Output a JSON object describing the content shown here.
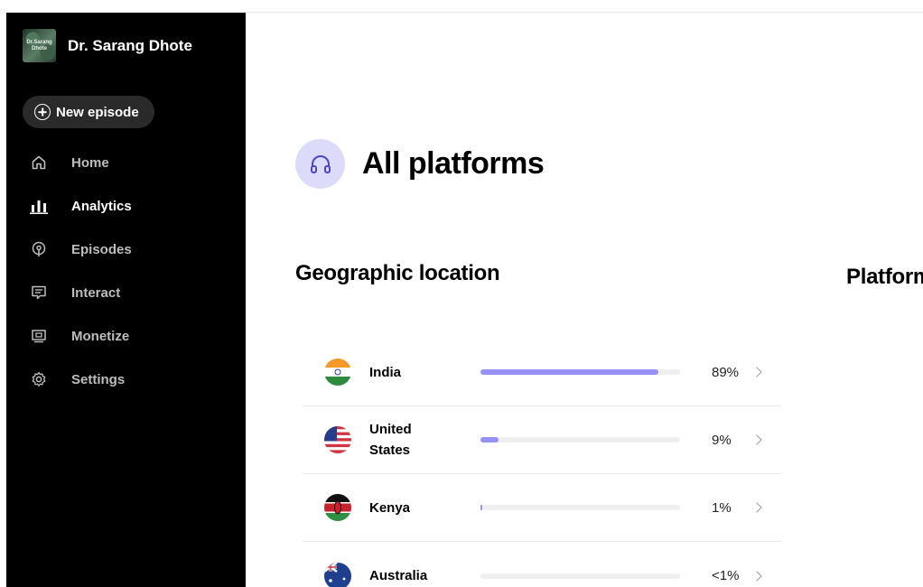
{
  "sidebar": {
    "show_name": "Dr. Sarang Dhote",
    "show_art_text": "Dr.Sarang Dhote",
    "new_episode_label": "New episode",
    "items": [
      {
        "label": "Home",
        "icon": "home-icon",
        "active": false
      },
      {
        "label": "Analytics",
        "icon": "bar-chart-icon",
        "active": true
      },
      {
        "label": "Episodes",
        "icon": "podcast-icon",
        "active": false
      },
      {
        "label": "Interact",
        "icon": "message-icon",
        "active": false
      },
      {
        "label": "Monetize",
        "icon": "monetize-icon",
        "active": false
      },
      {
        "label": "Settings",
        "icon": "gear-icon",
        "active": false
      }
    ]
  },
  "main": {
    "title": "All platforms",
    "header_icon": "headphones-icon",
    "geo_title": "Geographic location",
    "platform_title": "Platforms",
    "geo": [
      {
        "country": "India",
        "percent_label": "89%",
        "share": 0.89
      },
      {
        "country": "United States",
        "percent_label": "9%",
        "share": 0.09
      },
      {
        "country": "Kenya",
        "percent_label": "1%",
        "share": 0.01
      },
      {
        "country": "Australia",
        "percent_label": "<1%",
        "share": 0.0
      }
    ]
  },
  "colors": {
    "sidebar_bg": "#000000",
    "accent_bar": "#9691f5",
    "header_icon_bg": "#dcdcfa"
  }
}
